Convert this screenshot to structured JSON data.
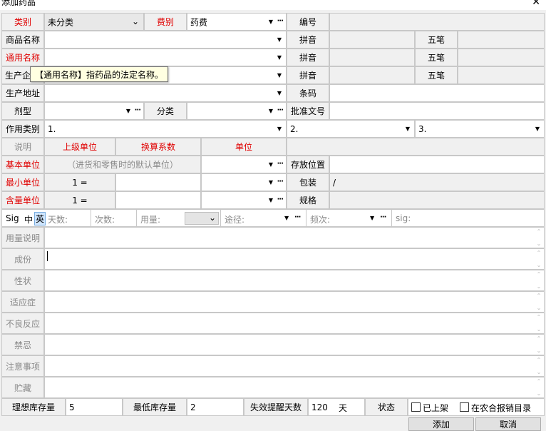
{
  "window": {
    "title": "添加药品",
    "close_glyph": "✕"
  },
  "row1": {
    "category_label": "类别",
    "category_value": "未分类",
    "fee_label": "费别",
    "fee_value": "药费",
    "code_label": "编号",
    "code_value": ""
  },
  "row2": {
    "trade_name_label": "商品名称",
    "pinyin_label": "拼音",
    "wubi_label": "五笔"
  },
  "row3": {
    "generic_name_label": "通用名称",
    "pinyin_label": "拼音",
    "wubi_label": "五笔"
  },
  "row4": {
    "manufacturer_label": "生产企",
    "pinyin_label": "拼音",
    "wubi_label": "五笔"
  },
  "tooltip": {
    "text": "【通用名称】指药品的法定名称。"
  },
  "row5": {
    "origin_label": "生产地址",
    "barcode_label": "条码"
  },
  "row6": {
    "dosage_label": "剂型",
    "class_label": "分类",
    "approval_label": "批准文号"
  },
  "row7": {
    "usage_label": "作用类别",
    "usage_1": "1.",
    "usage_2": "2.",
    "usage_3": "3."
  },
  "units_header": {
    "desc": "说明",
    "upper_unit": "上级单位",
    "factor": "换算系数",
    "unit": "单位"
  },
  "base_unit": {
    "label": "基本单位",
    "hint": "（进货和零售时的默认单位）",
    "storage_label": "存放位置"
  },
  "min_unit": {
    "label": "最小单位",
    "eq": "1 =",
    "package_label": "包装",
    "package_value": "/"
  },
  "content_unit": {
    "label": "含量单位",
    "eq": "1 =",
    "spec_label": "规格"
  },
  "sig": {
    "label": "Sig",
    "zh": "中",
    "en": "英",
    "days": "天数:",
    "times": "次数:",
    "dose": "用量:",
    "route": "途径:",
    "freq": "频次:",
    "sig_label": "sig:"
  },
  "text_fields": [
    {
      "label": "用量说明"
    },
    {
      "label": "成份"
    },
    {
      "label": "性状"
    },
    {
      "label": "适应症"
    },
    {
      "label": "不良反应"
    },
    {
      "label": "禁忌"
    },
    {
      "label": "注意事项"
    },
    {
      "label": "贮藏"
    }
  ],
  "stock": {
    "ideal_label": "理想库存量",
    "ideal_value": "5",
    "min_label": "最低库存量",
    "min_value": "2",
    "expiry_label": "失效提醒天数",
    "expiry_value": "120",
    "expiry_unit": "天",
    "status_label": "状态",
    "on_shelf": "已上架",
    "rural_catalog": "在农合报销目录"
  },
  "buttons": {
    "add": "添加",
    "cancel": "取消"
  },
  "glyphs": {
    "dropdown": "▼",
    "ellipsis": "···",
    "scroll_up": "⌃",
    "scroll_down": "⌄",
    "chevron": "⌄"
  }
}
